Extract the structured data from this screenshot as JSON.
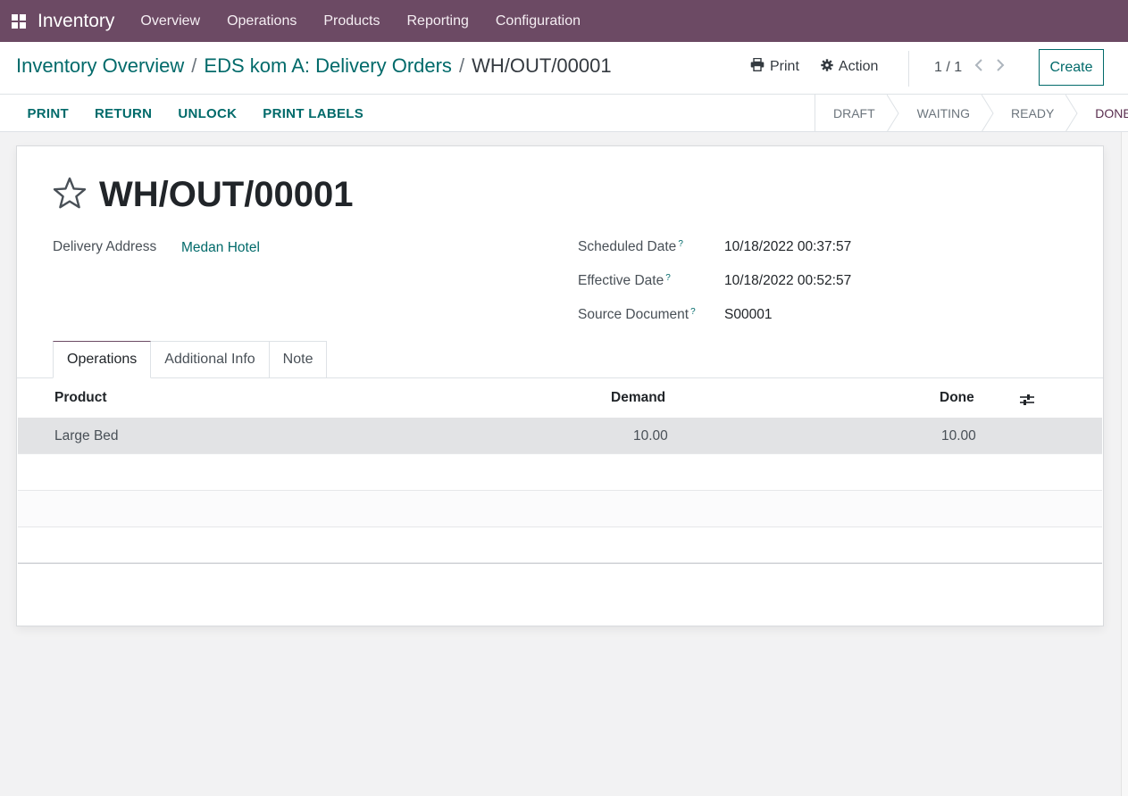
{
  "navbar": {
    "brand": "Inventory",
    "items": [
      "Overview",
      "Operations",
      "Products",
      "Reporting",
      "Configuration"
    ]
  },
  "breadcrumb": {
    "items": [
      "Inventory Overview",
      "EDS kom A: Delivery Orders"
    ],
    "separator": "/",
    "current": "WH/OUT/00001"
  },
  "control_panel": {
    "print_label": "Print",
    "action_label": "Action",
    "pager_value": "1 / 1",
    "create_label": "Create"
  },
  "buttons": [
    "PRINT",
    "RETURN",
    "UNLOCK",
    "PRINT LABELS"
  ],
  "statusbar": {
    "steps": [
      "DRAFT",
      "WAITING",
      "READY",
      "DONE"
    ],
    "active": "DONE"
  },
  "record": {
    "title": "WH/OUT/00001",
    "delivery_address_label": "Delivery Address",
    "delivery_address_value": "Medan Hotel",
    "scheduled_date_label": "Scheduled Date",
    "scheduled_date_value": "10/18/2022 00:37:57",
    "effective_date_label": "Effective Date",
    "effective_date_value": "10/18/2022 00:52:57",
    "source_document_label": "Source Document",
    "source_document_value": "S00001",
    "help_mark": "?"
  },
  "tabs": [
    "Operations",
    "Additional Info",
    "Note"
  ],
  "operations_table": {
    "columns": [
      "Product",
      "Demand",
      "Done"
    ],
    "rows": [
      {
        "product": "Large Bed",
        "demand": "10.00",
        "done": "10.00"
      }
    ]
  },
  "colors": {
    "navbar": "#6c4a64",
    "accent": "#016a6a",
    "active_status": "#5a2e4f"
  },
  "icons": [
    "apps-grid-icon",
    "printer-icon",
    "gear-icon",
    "chevron-left-icon",
    "chevron-right-icon",
    "star-icon",
    "optional-columns-icon"
  ]
}
